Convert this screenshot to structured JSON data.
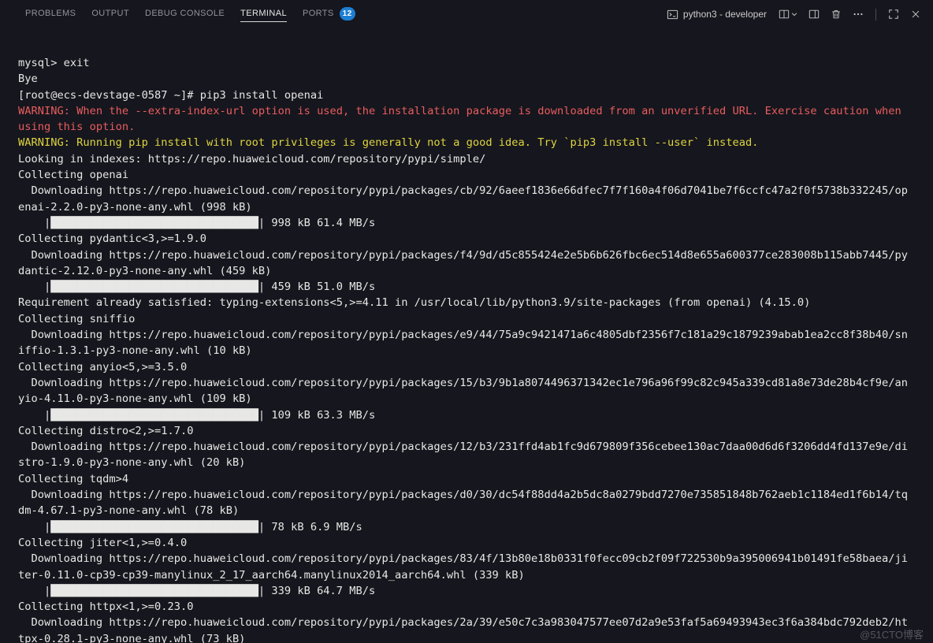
{
  "panel": {
    "tabs": [
      {
        "label": "PROBLEMS",
        "active": false
      },
      {
        "label": "OUTPUT",
        "active": false
      },
      {
        "label": "DEBUG CONSOLE",
        "active": false
      },
      {
        "label": "TERMINAL",
        "active": true
      },
      {
        "label": "PORTS",
        "active": false,
        "badge": "12"
      }
    ],
    "terminal_title": "python3 - developer"
  },
  "terminal": {
    "lines": [
      {
        "text": "mysql> exit"
      },
      {
        "text": "Bye"
      },
      {
        "text": "[root@ecs-devstage-0587 ~]# pip3 install openai"
      },
      {
        "text": "WARNING: When the --extra-index-url option is used, the installation package is downloaded from an unverified URL. Exercise caution when",
        "fg": "red"
      },
      {
        "text": "using this option.",
        "fg": "red"
      },
      {
        "text": "WARNING: Running pip install with root privileges is generally not a good idea. Try `pip3 install --user` instead.",
        "fg": "yellow"
      },
      {
        "text": "Looking in indexes: https://repo.huaweicloud.com/repository/pypi/simple/"
      },
      {
        "text": "Collecting openai"
      },
      {
        "text": "  Downloading https://repo.huaweicloud.com/repository/pypi/packages/cb/92/6aeef1836e66dfec7f7f160a4f06d7041be7f6ccfc47a2f0f5738b332245/op"
      },
      {
        "text": "enai-2.2.0-py3-none-any.whl (998 kB)"
      },
      {
        "text": "    |████████████████████████████████| 998 kB 61.4 MB/s"
      },
      {
        "text": "Collecting pydantic<3,>=1.9.0"
      },
      {
        "text": "  Downloading https://repo.huaweicloud.com/repository/pypi/packages/f4/9d/d5c855424e2e5b6b626fbc6ec514d8e655a600377ce283008b115abb7445/py"
      },
      {
        "text": "dantic-2.12.0-py3-none-any.whl (459 kB)"
      },
      {
        "text": "    |████████████████████████████████| 459 kB 51.0 MB/s"
      },
      {
        "text": "Requirement already satisfied: typing-extensions<5,>=4.11 in /usr/local/lib/python3.9/site-packages (from openai) (4.15.0)"
      },
      {
        "text": "Collecting sniffio"
      },
      {
        "text": "  Downloading https://repo.huaweicloud.com/repository/pypi/packages/e9/44/75a9c9421471a6c4805dbf2356f7c181a29c1879239abab1ea2cc8f38b40/sn"
      },
      {
        "text": "iffio-1.3.1-py3-none-any.whl (10 kB)"
      },
      {
        "text": "Collecting anyio<5,>=3.5.0"
      },
      {
        "text": "  Downloading https://repo.huaweicloud.com/repository/pypi/packages/15/b3/9b1a8074496371342ec1e796a96f99c82c945a339cd81a8e73de28b4cf9e/an"
      },
      {
        "text": "yio-4.11.0-py3-none-any.whl (109 kB)"
      },
      {
        "text": "    |████████████████████████████████| 109 kB 63.3 MB/s"
      },
      {
        "text": "Collecting distro<2,>=1.7.0"
      },
      {
        "text": "  Downloading https://repo.huaweicloud.com/repository/pypi/packages/12/b3/231ffd4ab1fc9d679809f356cebee130ac7daa00d6d6f3206dd4fd137e9e/di"
      },
      {
        "text": "stro-1.9.0-py3-none-any.whl (20 kB)"
      },
      {
        "text": "Collecting tqdm>4"
      },
      {
        "text": "  Downloading https://repo.huaweicloud.com/repository/pypi/packages/d0/30/dc54f88dd4a2b5dc8a0279bdd7270e735851848b762aeb1c1184ed1f6b14/tq"
      },
      {
        "text": "dm-4.67.1-py3-none-any.whl (78 kB)"
      },
      {
        "text": "    |████████████████████████████████| 78 kB 6.9 MB/s"
      },
      {
        "text": "Collecting jiter<1,>=0.4.0"
      },
      {
        "text": "  Downloading https://repo.huaweicloud.com/repository/pypi/packages/83/4f/13b80e18b0331f0fecc09cb2f09f722530b9a395006941b01491fe58baea/ji"
      },
      {
        "text": "ter-0.11.0-cp39-cp39-manylinux_2_17_aarch64.manylinux2014_aarch64.whl (339 kB)"
      },
      {
        "text": "    |████████████████████████████████| 339 kB 64.7 MB/s"
      },
      {
        "text": "Collecting httpx<1,>=0.23.0"
      },
      {
        "text": "  Downloading https://repo.huaweicloud.com/repository/pypi/packages/2a/39/e50c7c3a983047577ee07d2a9e53faf5a69493943ec3f6a384bdc792deb2/ht"
      },
      {
        "text": "tpx-0.28.1-py3-none-any.whl (73 kB)"
      }
    ]
  },
  "watermark": "@51CTO博客",
  "colors": {
    "background": "#16161e",
    "foreground": "#e7e7e5",
    "warning_red": "#e85d5d",
    "warning_yellow": "#ddd53f",
    "badge_blue": "#1d7fd4",
    "tab_inactive": "#92929e",
    "tab_active": "#e7e7e7"
  }
}
